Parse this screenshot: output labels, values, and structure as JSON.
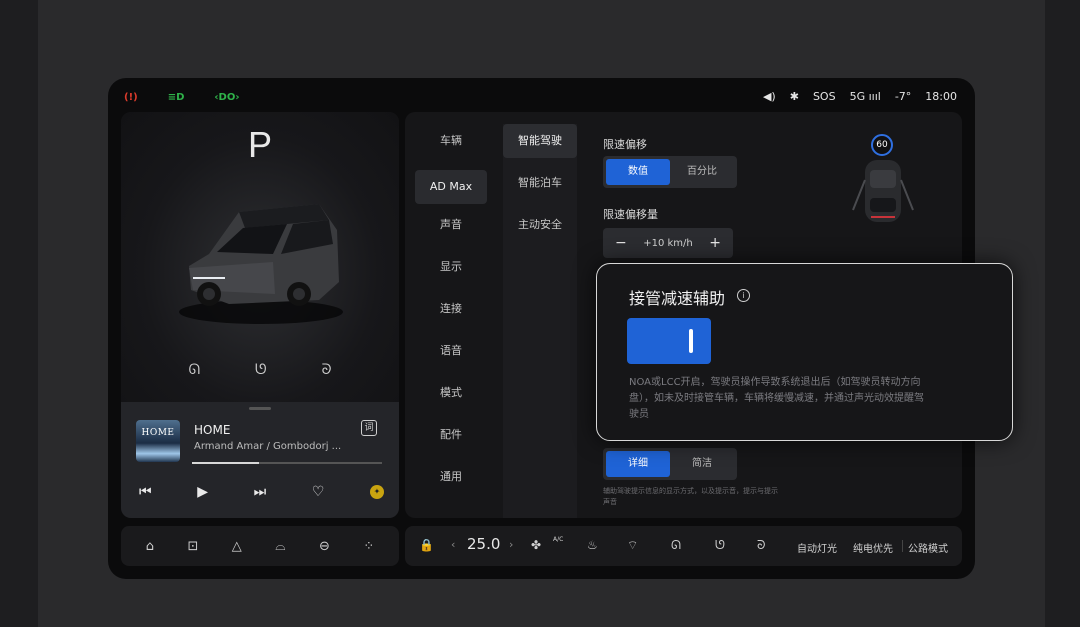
{
  "status_bar": {
    "indicators": [
      {
        "icon": "lights-fault-icon",
        "glyph": "(!)",
        "color": "#d93a2b"
      },
      {
        "icon": "low-beam-icon",
        "glyph": "≡D",
        "color": "#2fb34a"
      },
      {
        "icon": "position-lights-icon",
        "glyph": "‹DO›",
        "color": "#2fb34a"
      }
    ],
    "volume_glyph": "◀)",
    "bluetooth_glyph": "✱",
    "sos": "SOS",
    "signal": "5G ıııl",
    "temperature": "-7°",
    "time": "18:00"
  },
  "vehicle": {
    "gear": "P",
    "door_icons": [
      "ᘏ",
      "ᘎ",
      "ᘐ"
    ]
  },
  "media": {
    "album_text": "HOME",
    "title": "HOME",
    "artist": "Armand Amar / Gombodorj ...",
    "lyrics_label": "词",
    "progress": 0.35,
    "prev": "⏮",
    "play": "▶",
    "next": "⏭",
    "favorite": "♡",
    "medal": "✦"
  },
  "settings": {
    "nav_primary": [
      "车辆",
      "AD Max",
      "声音",
      "显示",
      "连接",
      "语音",
      "模式",
      "配件",
      "通用"
    ],
    "nav_secondary": [
      "智能驾驶",
      "智能泊车",
      "主动安全"
    ],
    "speed_offset": {
      "label": "限速偏移",
      "options": [
        "数值",
        "百分比"
      ],
      "selected": "数值"
    },
    "speed_offset_value": {
      "label": "限速偏移量",
      "minus": "−",
      "value": "+10 km/h",
      "plus": "+"
    },
    "detail_mode": {
      "options": [
        "详细",
        "简洁"
      ],
      "selected": "详细"
    },
    "fine_print": "辅助驾驶提示信息的显示方式，以及提示音，提示与提示声音",
    "speed_limit_badge": "60"
  },
  "popup": {
    "title": "接管减速辅助",
    "info": "i",
    "toggle_on": true,
    "description": "NOA或LCC开启，驾驶员操作导致系统退出后（如驾驶员转动方向盘），如未及时接管车辆，车辆将缓慢减速，并通过声光动效提醒驾驶员"
  },
  "dock": {
    "left_icons": [
      "⌂",
      "⊡",
      "△",
      "⌓",
      "⊖",
      "⁘"
    ],
    "lock": "🔒",
    "temp_left_chevron": "‹",
    "temperature": "25.0",
    "temp_right_chevron": "›",
    "fan": "✤",
    "fan_label": "A/C",
    "seat_heat": "♨",
    "defrost": "⌔",
    "wiper": "ᘏ",
    "mirror": "ᘎ",
    "light": "ᘐ",
    "auto_lights": "自动灯光",
    "power_priority": "纯电优先",
    "road_mode": "公路模式"
  },
  "colors": {
    "accent": "#1f63d6",
    "panel": "#161618"
  }
}
